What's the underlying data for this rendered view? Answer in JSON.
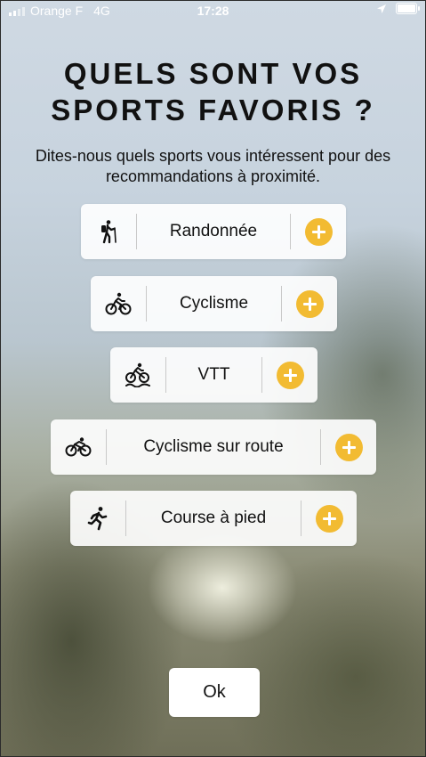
{
  "status_bar": {
    "carrier": "Orange F",
    "network": "4G",
    "time": "17:28"
  },
  "title_line1": "QUELS SONT VOS",
  "title_line2": "SPORTS FAVORIS ?",
  "subtitle": "Dites-nous quels sports vous intéressent pour des recommandations à proximité.",
  "sports": [
    {
      "label": "Randonnée",
      "icon": "hiking-icon"
    },
    {
      "label": "Cyclisme",
      "icon": "cycling-icon"
    },
    {
      "label": "VTT",
      "icon": "mountain-bike-icon"
    },
    {
      "label": "Cyclisme sur route",
      "icon": "road-cycling-icon"
    },
    {
      "label": "Course à pied",
      "icon": "running-icon"
    }
  ],
  "ok_label": "Ok",
  "colors": {
    "accent": "#f2bb32"
  }
}
